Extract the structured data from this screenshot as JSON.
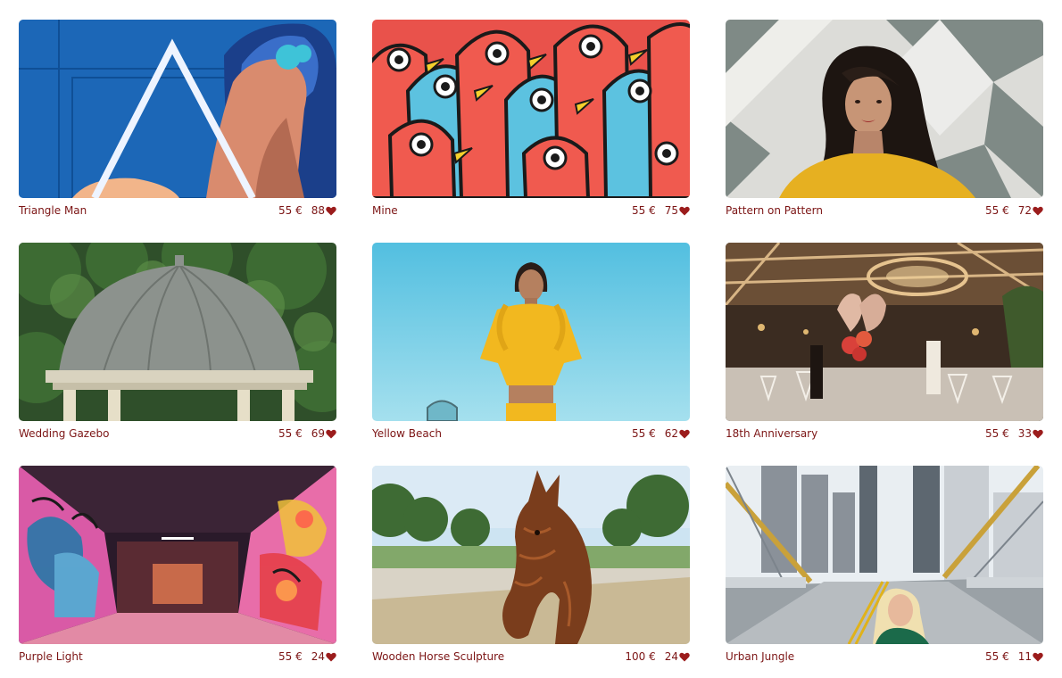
{
  "gallery": {
    "items": [
      {
        "title": "Triangle Man",
        "price": "55 €",
        "likes": "88"
      },
      {
        "title": "Mine",
        "price": "55 €",
        "likes": "75"
      },
      {
        "title": "Pattern on Pattern",
        "price": "55 €",
        "likes": "72"
      },
      {
        "title": "Wedding Gazebo",
        "price": "55 €",
        "likes": "69"
      },
      {
        "title": "Yellow Beach",
        "price": "55 €",
        "likes": "62"
      },
      {
        "title": "18th Anniversary",
        "price": "55 €",
        "likes": "33"
      },
      {
        "title": "Purple Light",
        "price": "55 €",
        "likes": "24"
      },
      {
        "title": "Wooden Horse Sculpture",
        "price": "100 €",
        "likes": "24"
      },
      {
        "title": "Urban Jungle",
        "price": "55 €",
        "likes": "11"
      }
    ]
  },
  "icons": {
    "like": "heart-icon"
  },
  "colors": {
    "text": "#7c1515",
    "heart": "#9b1c1c",
    "background": "#ffffff"
  }
}
